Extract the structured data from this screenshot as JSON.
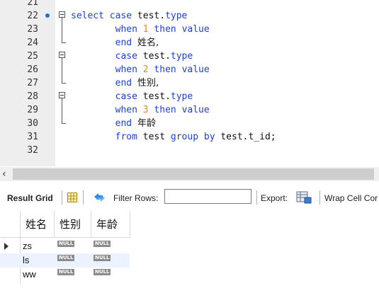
{
  "editor": {
    "lines": [
      {
        "num": "21",
        "parts": []
      },
      {
        "num": "22",
        "breakpoint": true,
        "fold": "start",
        "parts": [
          {
            "t": "select",
            "c": "kw"
          },
          {
            "t": " "
          },
          {
            "t": "case",
            "c": "kw"
          },
          {
            "t": " test."
          },
          {
            "t": "type",
            "c": "kw"
          }
        ]
      },
      {
        "num": "23",
        "parts": [
          {
            "t": "        "
          },
          {
            "t": "when",
            "c": "kw"
          },
          {
            "t": " "
          },
          {
            "t": "1",
            "c": "num"
          },
          {
            "t": " "
          },
          {
            "t": "then",
            "c": "kw"
          },
          {
            "t": " "
          },
          {
            "t": "value",
            "c": "kw"
          }
        ]
      },
      {
        "num": "24",
        "fold": "end",
        "parts": [
          {
            "t": "        "
          },
          {
            "t": "end",
            "c": "kw"
          },
          {
            "t": " "
          },
          {
            "t": "姓名,",
            "c": "cjk"
          }
        ]
      },
      {
        "num": "25",
        "fold": "start",
        "parts": [
          {
            "t": "        "
          },
          {
            "t": "case",
            "c": "kw"
          },
          {
            "t": " test."
          },
          {
            "t": "type",
            "c": "kw"
          }
        ]
      },
      {
        "num": "26",
        "parts": [
          {
            "t": "        "
          },
          {
            "t": "when",
            "c": "kw"
          },
          {
            "t": " "
          },
          {
            "t": "2",
            "c": "num"
          },
          {
            "t": " "
          },
          {
            "t": "then",
            "c": "kw"
          },
          {
            "t": " "
          },
          {
            "t": "value",
            "c": "kw"
          }
        ]
      },
      {
        "num": "27",
        "fold": "end",
        "parts": [
          {
            "t": "        "
          },
          {
            "t": "end",
            "c": "kw"
          },
          {
            "t": " "
          },
          {
            "t": "性别,",
            "c": "cjk"
          }
        ]
      },
      {
        "num": "28",
        "fold": "start",
        "parts": [
          {
            "t": "        "
          },
          {
            "t": "case",
            "c": "kw"
          },
          {
            "t": " test."
          },
          {
            "t": "type",
            "c": "kw"
          }
        ]
      },
      {
        "num": "29",
        "parts": [
          {
            "t": "        "
          },
          {
            "t": "when",
            "c": "kw"
          },
          {
            "t": " "
          },
          {
            "t": "3",
            "c": "num"
          },
          {
            "t": " "
          },
          {
            "t": "then",
            "c": "kw"
          },
          {
            "t": " "
          },
          {
            "t": "value",
            "c": "kw"
          }
        ]
      },
      {
        "num": "30",
        "fold": "end",
        "parts": [
          {
            "t": "        "
          },
          {
            "t": "end",
            "c": "kw"
          },
          {
            "t": " "
          },
          {
            "t": "年龄",
            "c": "cjk"
          }
        ]
      },
      {
        "num": "31",
        "parts": [
          {
            "t": "        "
          },
          {
            "t": "from",
            "c": "kw"
          },
          {
            "t": " test "
          },
          {
            "t": "group",
            "c": "kw"
          },
          {
            "t": " "
          },
          {
            "t": "by",
            "c": "kw"
          },
          {
            "t": " test.t_id;"
          }
        ]
      },
      {
        "num": "32",
        "parts": []
      }
    ]
  },
  "toolbar": {
    "result_grid_label": "Result Grid",
    "filter_rows_label": "Filter Rows:",
    "filter_value": "",
    "export_label": "Export:",
    "wrap_label": "Wrap Cell Cor"
  },
  "grid": {
    "columns": [
      "姓名",
      "性别",
      "年龄"
    ],
    "null_label": "NULL",
    "rows": [
      {
        "name": "zs",
        "gender": "NULL",
        "age": "NULL",
        "current": true
      },
      {
        "name": "ls",
        "gender": "NULL",
        "age": "NULL",
        "current": false
      },
      {
        "name": "ww",
        "gender": "NULL",
        "age": "NULL",
        "current": false
      }
    ]
  },
  "colors": {
    "keyword": "#1f3fd6",
    "number": "#e08a1e",
    "gutter": "#eeeeee",
    "alt_row": "#ecf2ff"
  }
}
